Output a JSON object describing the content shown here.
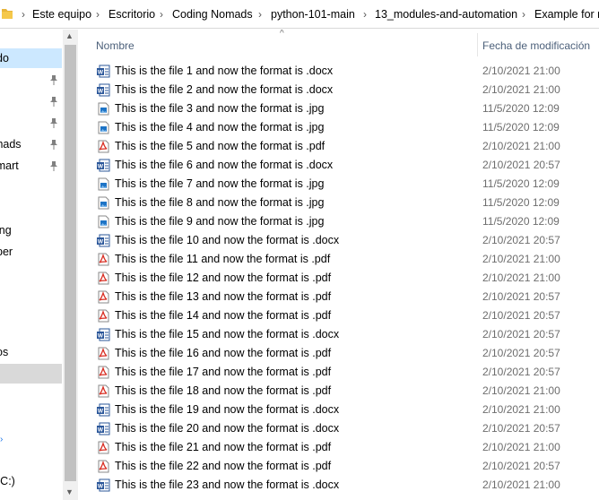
{
  "breadcrumb": [
    {
      "label": "Este equipo",
      "name": "breadcrumb-este-equipo"
    },
    {
      "label": "Escritorio",
      "name": "breadcrumb-escritorio"
    },
    {
      "label": "Coding Nomads",
      "name": "breadcrumb-coding-nomads"
    },
    {
      "label": "python-101-main",
      "name": "breadcrumb-python-101-main"
    },
    {
      "label": "13_modules-and-automation",
      "name": "breadcrumb-13-modules-and-automation"
    },
    {
      "label": "Example for re",
      "name": "breadcrumb-example-folder"
    }
  ],
  "nav": {
    "items": [
      {
        "label": "do",
        "state": "selected",
        "pinned": false
      },
      {
        "label": "",
        "state": "normal",
        "pinned": true
      },
      {
        "label": "",
        "state": "normal",
        "pinned": true
      },
      {
        "label": "",
        "state": "normal",
        "pinned": true
      },
      {
        "label": "omads",
        "state": "normal",
        "pinned": true
      },
      {
        "label": "almart",
        "state": "normal",
        "pinned": true
      },
      {
        "label": "ing",
        "state": "normal",
        "pinned": false
      },
      {
        "label": "per",
        "state": "normal",
        "pinned": false
      },
      {
        "label": "os",
        "state": "normal",
        "pinned": false
      },
      {
        "label": "",
        "state": "active",
        "pinned": false
      },
      {
        "label": "(C:)",
        "state": "normal",
        "pinned": false
      }
    ]
  },
  "columns": {
    "name": "Nombre",
    "date": "Fecha de modificación"
  },
  "files": [
    {
      "name": "This is the file 1 and now the format is .docx",
      "type": "docx",
      "date": "2/10/2021 21:00"
    },
    {
      "name": "This is the file 2 and now the format is .docx",
      "type": "docx",
      "date": "2/10/2021 21:00"
    },
    {
      "name": "This is the file 3 and now the format is .jpg",
      "type": "jpg",
      "date": "11/5/2020 12:09"
    },
    {
      "name": "This is the file 4 and now the format is .jpg",
      "type": "jpg",
      "date": "11/5/2020 12:09"
    },
    {
      "name": "This is the file 5 and now the format is .pdf",
      "type": "pdf",
      "date": "2/10/2021 21:00"
    },
    {
      "name": "This is the file 6 and now the format is .docx",
      "type": "docx",
      "date": "2/10/2021 20:57"
    },
    {
      "name": "This is the file 7 and now the format is .jpg",
      "type": "jpg",
      "date": "11/5/2020 12:09"
    },
    {
      "name": "This is the file 8 and now the format is .jpg",
      "type": "jpg",
      "date": "11/5/2020 12:09"
    },
    {
      "name": "This is the file 9 and now the format is .jpg",
      "type": "jpg",
      "date": "11/5/2020 12:09"
    },
    {
      "name": "This is the file 10 and now the format is .docx",
      "type": "docx",
      "date": "2/10/2021 20:57"
    },
    {
      "name": "This is the file 11 and now the format is .pdf",
      "type": "pdf",
      "date": "2/10/2021 21:00"
    },
    {
      "name": "This is the file 12 and now the format is .pdf",
      "type": "pdf",
      "date": "2/10/2021 21:00"
    },
    {
      "name": "This is the file 13 and now the format is .pdf",
      "type": "pdf",
      "date": "2/10/2021 20:57"
    },
    {
      "name": "This is the file 14 and now the format is .pdf",
      "type": "pdf",
      "date": "2/10/2021 20:57"
    },
    {
      "name": "This is the file 15 and now the format is .docx",
      "type": "docx",
      "date": "2/10/2021 20:57"
    },
    {
      "name": "This is the file 16 and now the format is .pdf",
      "type": "pdf",
      "date": "2/10/2021 20:57"
    },
    {
      "name": "This is the file 17 and now the format is .pdf",
      "type": "pdf",
      "date": "2/10/2021 20:57"
    },
    {
      "name": "This is the file 18 and now the format is .pdf",
      "type": "pdf",
      "date": "2/10/2021 21:00"
    },
    {
      "name": "This is the file 19 and now the format is .docx",
      "type": "docx",
      "date": "2/10/2021 21:00"
    },
    {
      "name": "This is the file 20 and now the format is .docx",
      "type": "docx",
      "date": "2/10/2021 20:57"
    },
    {
      "name": "This is the file 21 and now the format is .pdf",
      "type": "pdf",
      "date": "2/10/2021 21:00"
    },
    {
      "name": "This is the file 22 and now the format is .pdf",
      "type": "pdf",
      "date": "2/10/2021 20:57"
    },
    {
      "name": "This is the file 23 and now the format is .docx",
      "type": "docx",
      "date": "2/10/2021 21:00"
    }
  ],
  "icons": {
    "docx": "word-document-icon",
    "jpg": "jpg-image-icon",
    "pdf": "pdf-document-icon"
  },
  "colors": {
    "selected": "#cce8ff",
    "word": "#2b579a",
    "pdf": "#d93025",
    "image": "#1e74c6"
  }
}
